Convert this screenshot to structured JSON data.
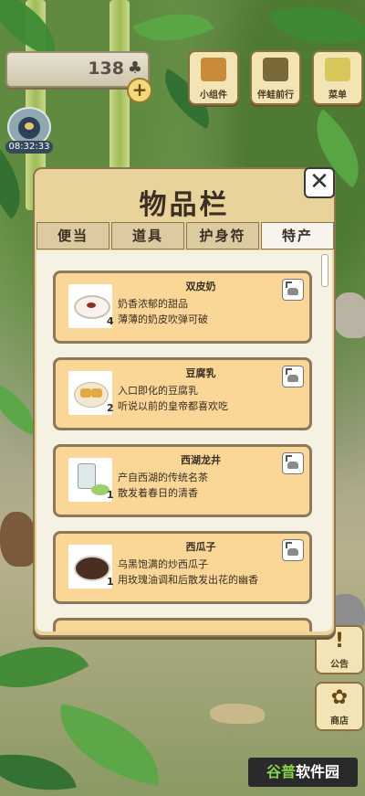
{
  "hud": {
    "clover_count": "138",
    "clover_icon": "clover-icon",
    "plus_label": "+",
    "clock": "08:32:33",
    "buttons": [
      {
        "label": "小组件",
        "icon": "widget-icon",
        "color": "#c98a3a"
      },
      {
        "label": "伴蛙前行",
        "icon": "frog-journey-icon",
        "color": "#7a6a3a"
      },
      {
        "label": "菜单",
        "icon": "menu-icon",
        "color": "#d8c75a"
      }
    ],
    "side_buttons": [
      {
        "label": "公告",
        "glyph": "!"
      },
      {
        "label": "商店",
        "glyph": "✿"
      }
    ]
  },
  "panel": {
    "title": "物品栏",
    "close_label": "✕",
    "tabs": [
      {
        "label": "便当",
        "active": false
      },
      {
        "label": "道具",
        "active": false
      },
      {
        "label": "护身符",
        "active": false
      },
      {
        "label": "特产",
        "active": true
      }
    ],
    "items": [
      {
        "name": "双皮奶",
        "qty": "4",
        "desc1": "奶香浓郁的甜品",
        "desc2": "薄薄的奶皮吹弹可破",
        "icon": "milk-pudding-icon"
      },
      {
        "name": "豆腐乳",
        "qty": "2",
        "desc1": "入口即化的豆腐乳",
        "desc2": "听说以前的皇帝都喜欢吃",
        "icon": "fermented-tofu-icon"
      },
      {
        "name": "西湖龙井",
        "qty": "1",
        "desc1": "产自西湖的传统名茶",
        "desc2": "散发着春日的清香",
        "icon": "longjing-tea-icon"
      },
      {
        "name": "西瓜子",
        "qty": "1",
        "desc1": "乌黑饱满的炒西瓜子",
        "desc2": "用玫瑰油调和后散发出花的幽香",
        "icon": "watermelon-seeds-icon"
      }
    ]
  },
  "watermark": {
    "part1": "谷普",
    "part2": "软件园"
  }
}
